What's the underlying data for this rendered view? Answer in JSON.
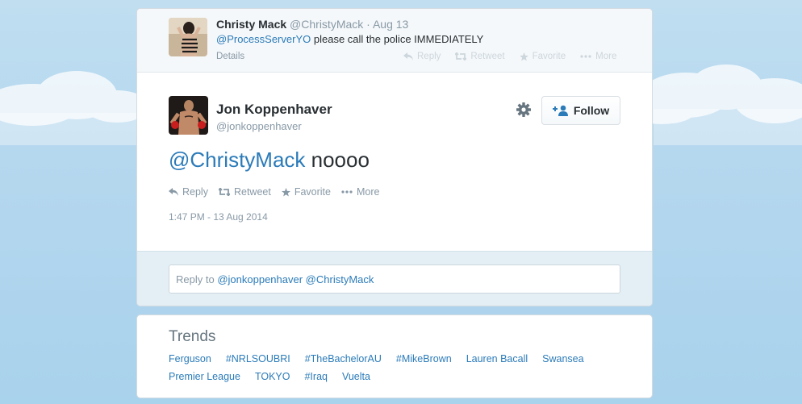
{
  "previous_tweet": {
    "author_name": "Christy Mack",
    "author_handle": "@ChristyMack",
    "separator": "·",
    "date": "Aug 13",
    "mention": "@ProcessServerYO",
    "text": "please call the police IMMEDIATELY",
    "details_label": "Details",
    "actions": {
      "reply": "Reply",
      "retweet": "Retweet",
      "favorite": "Favorite",
      "more": "More"
    }
  },
  "main_tweet": {
    "author_name": "Jon Koppenhaver",
    "author_handle": "@jonkoppenhaver",
    "follow_label": "Follow",
    "mention": "@ChristyMack",
    "text": "noooo",
    "actions": {
      "reply": "Reply",
      "retweet": "Retweet",
      "favorite": "Favorite",
      "more": "More"
    },
    "timestamp": "1:47 PM - 13 Aug 2014"
  },
  "reply_box": {
    "prefix": "Reply to",
    "mention1": "@jonkoppenhaver",
    "mention2": "@ChristyMack"
  },
  "trends": {
    "title": "Trends",
    "row1": [
      "Ferguson",
      "#NRLSOUBRI",
      "#TheBachelorAU",
      "#MikeBrown",
      "Lauren Bacall",
      "Swansea"
    ],
    "row2": [
      "Premier League",
      "TOKYO",
      "#Iraq",
      "Vuelta"
    ]
  },
  "colors": {
    "link": "#2b7bb9",
    "muted": "#8899a6",
    "text": "#292f33",
    "sky": "#b6d8ef"
  },
  "icons": [
    "reply-icon",
    "retweet-icon",
    "favorite-star-icon",
    "more-dots-icon",
    "gear-icon",
    "add-user-icon"
  ]
}
